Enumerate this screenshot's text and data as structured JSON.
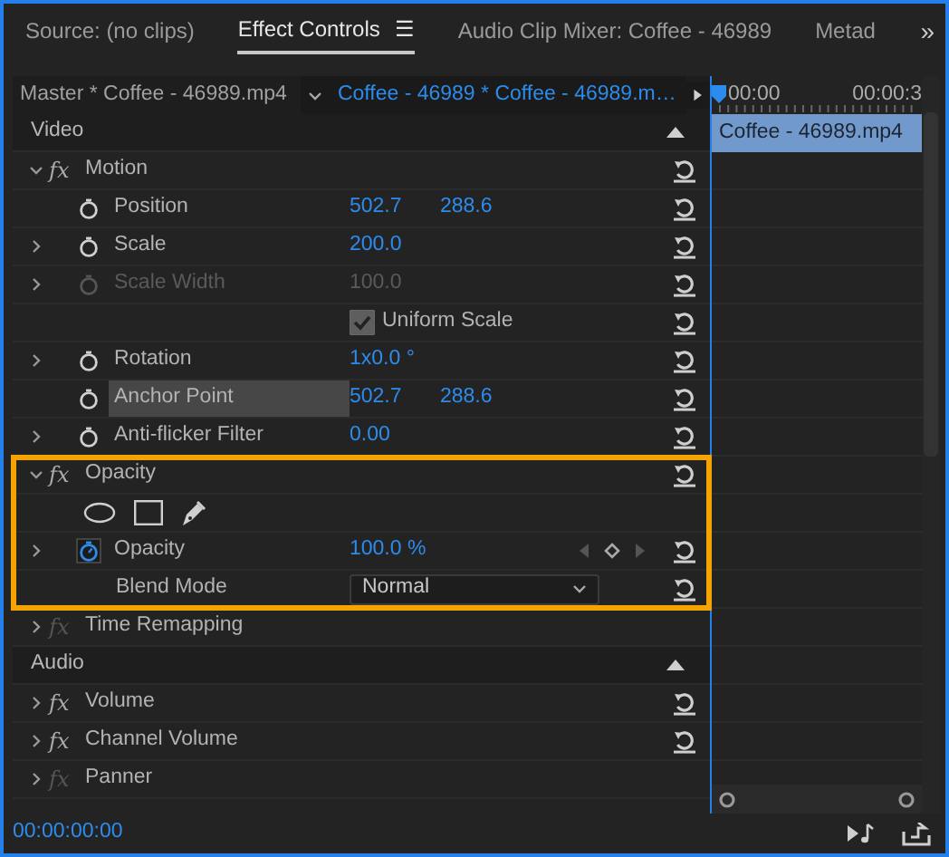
{
  "tabs": [
    {
      "label": "Source: (no clips)",
      "selected": false
    },
    {
      "label": "Effect Controls",
      "selected": true,
      "menu": "☰"
    },
    {
      "label": "Audio Clip Mixer: Coffee - 46989",
      "selected": false
    },
    {
      "label": "Metad",
      "selected": false
    }
  ],
  "overflow": "»",
  "clip_bar": {
    "master": "Master * Coffee - 46989.mp4",
    "sequence": "Coffee - 46989 * Coffee - 46989.m…"
  },
  "timeline": {
    "ticks": [
      "00:00",
      "00:00:3"
    ],
    "clip": "Coffee - 46989.mp4"
  },
  "sections": [
    {
      "title": "Video",
      "expanded": true,
      "effects": [
        {
          "fx": "fx",
          "name": "Motion",
          "expanded": true,
          "enabled": true,
          "highlighted": false,
          "reset": true,
          "properties": [
            {
              "kind": "param",
              "name": "Position",
              "values": [
                "502.7",
                "288.6"
              ],
              "expandable": false,
              "disabled": false,
              "animated": false,
              "selected": false,
              "keyframes": false,
              "reset": true
            },
            {
              "kind": "param",
              "name": "Scale",
              "values": [
                "200.0"
              ],
              "expandable": true,
              "disabled": false,
              "animated": false,
              "selected": false,
              "keyframes": false,
              "reset": true
            },
            {
              "kind": "param",
              "name": "Scale Width",
              "values": [
                "100.0"
              ],
              "expandable": true,
              "disabled": true,
              "animated": false,
              "selected": false,
              "keyframes": false,
              "reset": true
            },
            {
              "kind": "checkbox",
              "label": "Uniform Scale",
              "checked": true,
              "reset": true
            },
            {
              "kind": "param",
              "name": "Rotation",
              "values": [
                "1x0.0 °"
              ],
              "expandable": true,
              "disabled": false,
              "animated": false,
              "selected": false,
              "keyframes": false,
              "reset": true
            },
            {
              "kind": "param",
              "name": "Anchor Point",
              "values": [
                "502.7",
                "288.6"
              ],
              "expandable": false,
              "disabled": false,
              "animated": false,
              "selected": true,
              "keyframes": false,
              "reset": true
            },
            {
              "kind": "param",
              "name": "Anti-flicker Filter",
              "values": [
                "0.00"
              ],
              "expandable": true,
              "disabled": false,
              "animated": false,
              "selected": false,
              "keyframes": false,
              "reset": true
            }
          ]
        },
        {
          "fx": "fx",
          "name": "Opacity",
          "expanded": true,
          "enabled": true,
          "highlighted": true,
          "reset": true,
          "properties": [
            {
              "kind": "mask-tools",
              "reset": false
            },
            {
              "kind": "param",
              "name": "Opacity",
              "values": [
                "100.0 %"
              ],
              "expandable": true,
              "disabled": false,
              "animated": true,
              "selected": false,
              "keyframes": true,
              "reset": true
            },
            {
              "kind": "dropdown",
              "name": "Blend Mode",
              "value": "Normal",
              "reset": true
            }
          ]
        },
        {
          "fx": "fx",
          "name": "Time Remapping",
          "expanded": false,
          "enabled": false,
          "highlighted": false,
          "reset": false
        }
      ]
    },
    {
      "title": "Audio",
      "expanded": true,
      "effects": [
        {
          "fx": "fx",
          "name": "Volume",
          "expanded": false,
          "enabled": true,
          "highlighted": false,
          "reset": true
        },
        {
          "fx": "fx",
          "name": "Channel Volume",
          "expanded": false,
          "enabled": true,
          "highlighted": false,
          "reset": true
        },
        {
          "fx": "fx",
          "name": "Panner",
          "expanded": false,
          "enabled": false,
          "highlighted": false,
          "reset": false
        }
      ]
    }
  ],
  "timecode": "00:00:00:00"
}
